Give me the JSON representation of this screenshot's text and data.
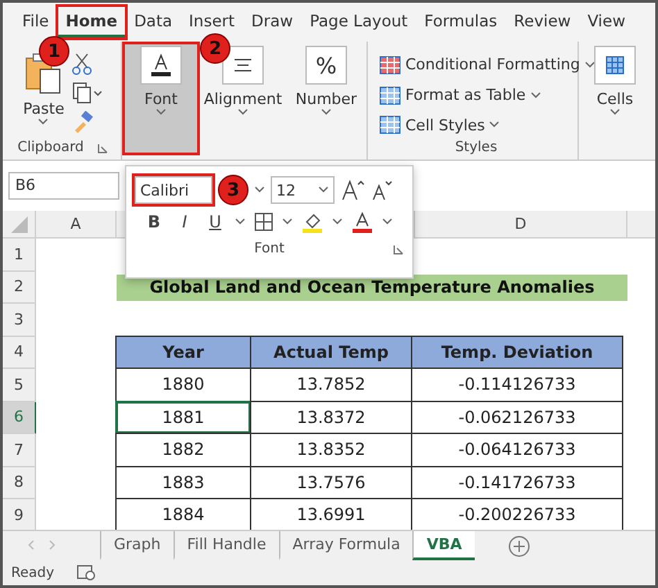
{
  "ribbon_tabs": [
    {
      "label": "File",
      "selected": false,
      "highlighted": false
    },
    {
      "label": "Home",
      "selected": true,
      "highlighted": true
    },
    {
      "label": "Data",
      "selected": false,
      "highlighted": false
    },
    {
      "label": "Insert",
      "selected": false,
      "highlighted": false
    },
    {
      "label": "Draw",
      "selected": false,
      "highlighted": false
    },
    {
      "label": "Page Layout",
      "selected": false,
      "highlighted": false
    },
    {
      "label": "Formulas",
      "selected": false,
      "highlighted": false
    },
    {
      "label": "Review",
      "selected": false,
      "highlighted": false
    },
    {
      "label": "View",
      "selected": false,
      "highlighted": false
    }
  ],
  "ribbon": {
    "paste": "Paste",
    "clipboard_label": "Clipboard",
    "font": {
      "label": "Font",
      "selected": true,
      "highlighted": true
    },
    "alignment": "Alignment",
    "number": "Number",
    "number_icon": "%",
    "styles": [
      "Conditional Formatting",
      "Format as Table",
      "Cell Styles"
    ],
    "styles_label": "Styles",
    "cells": "Cells"
  },
  "name_box": "B6",
  "font_popup": {
    "font_name": "Calibri",
    "font_name_highlighted": true,
    "font_size": "12",
    "bold": "B",
    "italic": "I",
    "underline": "U",
    "label": "Font"
  },
  "column_headers": [
    {
      "kind": "letter",
      "label": "A"
    },
    {
      "kind": "blank"
    },
    {
      "kind": "blank"
    },
    {
      "kind": "letter",
      "label": "D"
    },
    {
      "kind": "blank"
    }
  ],
  "row_headers": [
    {
      "label": "1",
      "selected": false
    },
    {
      "label": "2",
      "selected": false
    },
    {
      "label": "3",
      "selected": false
    },
    {
      "label": "4",
      "selected": false
    },
    {
      "label": "5",
      "selected": false
    },
    {
      "label": "6",
      "selected": true
    },
    {
      "label": "7",
      "selected": false
    },
    {
      "label": "8",
      "selected": false
    },
    {
      "label": "9",
      "selected": false
    }
  ],
  "title": "Global Land and Ocean Temperature Anomalies",
  "table": {
    "columns": [
      "Year",
      "Actual Temp",
      "Temp. Deviation"
    ],
    "rows": [
      {
        "cells": [
          {
            "text": "1880",
            "selected": false
          },
          {
            "text": "13.7852",
            "selected": false
          },
          {
            "text": "-0.114126733",
            "selected": false
          }
        ]
      },
      {
        "cells": [
          {
            "text": "1881",
            "selected": true
          },
          {
            "text": "13.8372",
            "selected": false
          },
          {
            "text": "-0.062126733",
            "selected": false
          }
        ]
      },
      {
        "cells": [
          {
            "text": "1882",
            "selected": false
          },
          {
            "text": "13.8352",
            "selected": false
          },
          {
            "text": "-0.064126733",
            "selected": false
          }
        ]
      },
      {
        "cells": [
          {
            "text": "1883",
            "selected": false
          },
          {
            "text": "13.7576",
            "selected": false
          },
          {
            "text": "-0.141726733",
            "selected": false
          }
        ]
      },
      {
        "cells": [
          {
            "text": "1884",
            "selected": false
          },
          {
            "text": "13.6991",
            "selected": false
          },
          {
            "text": "-0.200226733",
            "selected": false
          }
        ]
      }
    ]
  },
  "sheet_tabs": [
    {
      "label": "Graph",
      "selected": false
    },
    {
      "label": "Fill Handle",
      "selected": false
    },
    {
      "label": "Array Formula",
      "selected": false
    },
    {
      "label": "VBA",
      "selected": true
    }
  ],
  "status_bar": {
    "text": "Ready"
  },
  "callouts": [
    {
      "number": "1"
    },
    {
      "number": "2"
    },
    {
      "number": "3"
    }
  ]
}
